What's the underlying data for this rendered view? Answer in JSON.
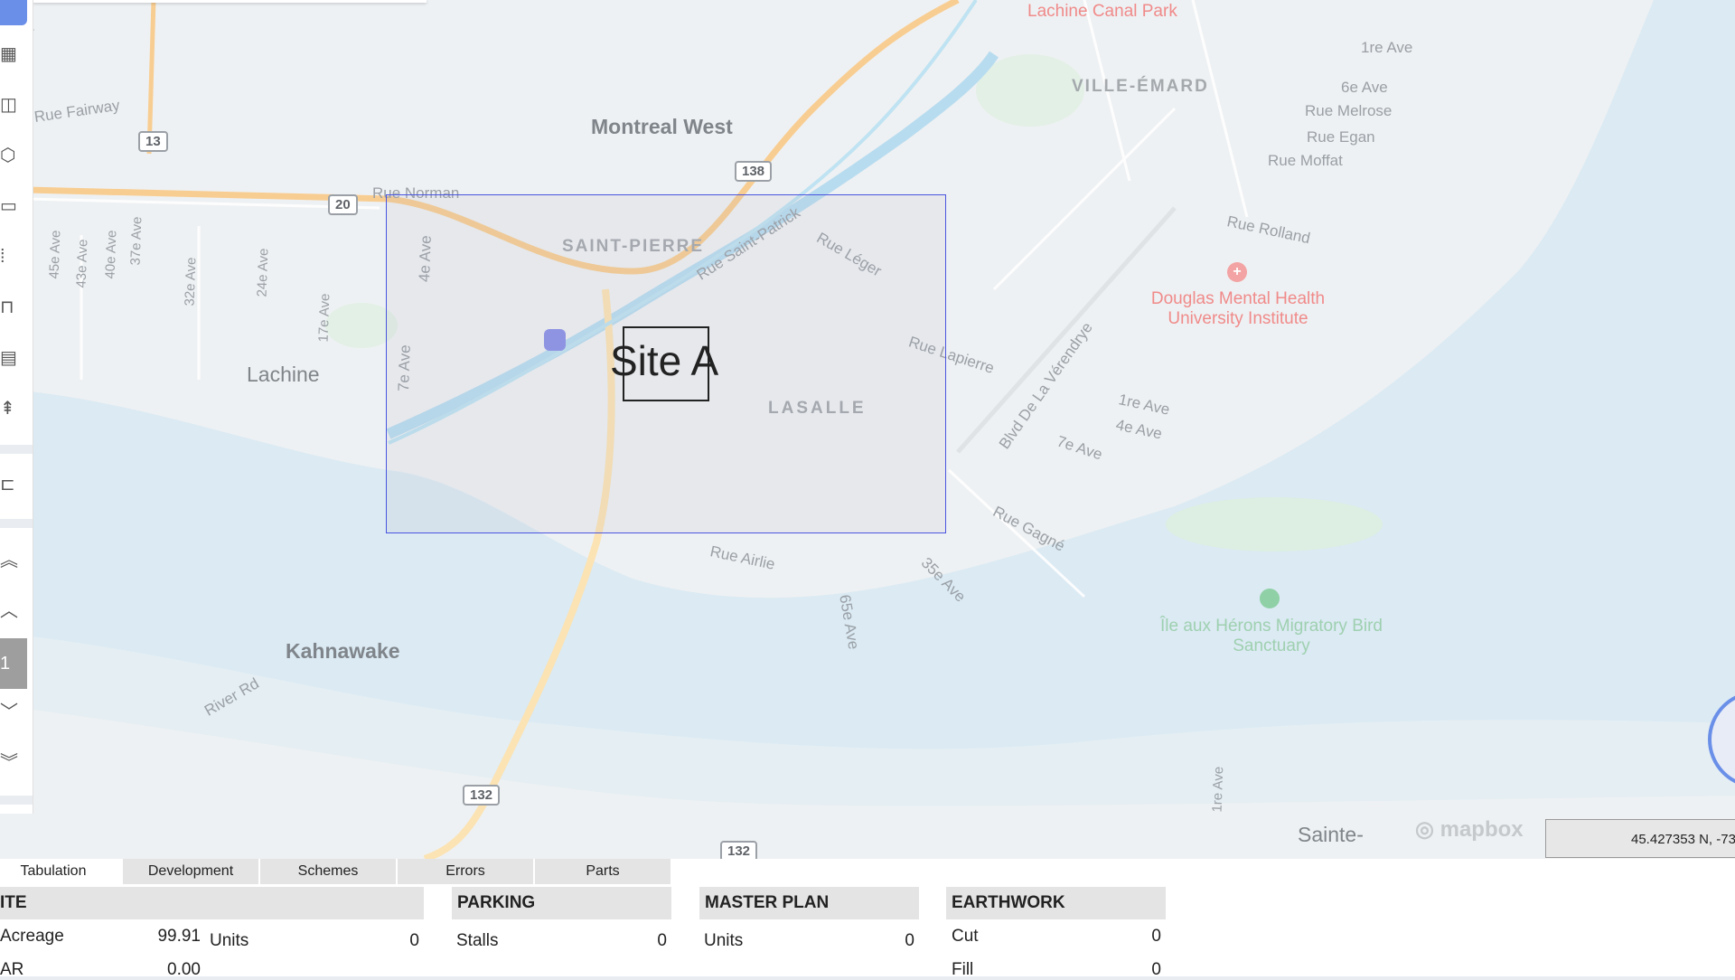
{
  "map": {
    "labels": {
      "lachine_canal_park": "Lachine Canal Park",
      "montreal_west": "Montreal West",
      "ville_emard": "VILLE-ÉMARD",
      "saint_pierre": "SAINT-PIERRE",
      "lachine": "Lachine",
      "lasalle": "LASALLE",
      "kahnawake": "Kahnawake",
      "douglas": "Douglas Mental Health University Institute",
      "heron": "Île aux Hérons Migratory Bird Sanctuary",
      "sainte": "Sainte-",
      "rue_norman": "Rue Norman",
      "rue_fairway": "Rue Fairway",
      "rue_saint_patrick": "Rue Saint-Patrick",
      "rue_leger": "Rue Léger",
      "rue_lapierre": "Rue Lapierre",
      "rue_airlie": "Rue Airlie",
      "blvd_verendrye": "Blvd De La Vérendrye",
      "rue_melrose": "Rue Melrose",
      "rue_egan": "Rue Egan",
      "rue_moffat": "Rue Moffat",
      "rue_rolland": "Rue Rolland",
      "rue_gagne": "Rue Gagné",
      "river_rd": "River Rd",
      "ave_1re": "1re Ave",
      "ave_6e": "6e Ave",
      "ave_4e": "4e Ave",
      "ave_7e": "7e Ave",
      "ave_1re_b": "1re Ave",
      "ave_4e_b": "4e Ave",
      "ave_7e_b": "7e Ave",
      "ave_35e": "35e Ave",
      "ave_65e": "65e Ave",
      "ave_45e": "45e Ave",
      "ave_43e": "43e Ave",
      "ave_40e": "40e Ave",
      "ave_37e": "37e Ave",
      "ave_32e": "32e Ave",
      "ave_24e": "24e Ave",
      "ave_17e": "17e Ave",
      "ave_1re_c": "1re Ave"
    },
    "shields": {
      "r13": "13",
      "r138": "138",
      "r20": "20",
      "r132a": "132",
      "r132b": "132"
    },
    "site_label": "Site A",
    "attribution": "mapbox",
    "coords": "45.427353 N, -73"
  },
  "tabs": [
    {
      "label": "Tabulation"
    },
    {
      "label": "Development"
    },
    {
      "label": "Schemes"
    },
    {
      "label": "Errors"
    },
    {
      "label": "Parts"
    }
  ],
  "panels": {
    "site": {
      "title": "ITE",
      "acreage_label": "Acreage",
      "acreage": "99.91",
      "units_label": "Units",
      "units": "0",
      "far_label": "AR",
      "far": "0.00"
    },
    "parking": {
      "title": "PARKING",
      "stalls_label": "Stalls",
      "stalls": "0"
    },
    "master": {
      "title": "MASTER PLAN",
      "units_label": "Units",
      "units": "0"
    },
    "earthwork": {
      "title": "EARTHWORK",
      "cut_label": "Cut",
      "cut": "0",
      "fill_label": "Fill",
      "fill": "0"
    }
  },
  "colors": {
    "accent": "#4a55e0",
    "water": "#cfe6f5",
    "highway": "#f6c27a"
  },
  "icons": [
    "building-icon",
    "layers-icon",
    "polygon-icon",
    "car-icon",
    "parking-icon",
    "bench-icon",
    "ruler-icon",
    "tree-icon",
    "add-shape-icon",
    "chevron-double-up-icon",
    "chevron-up-icon",
    "chevron-down-icon",
    "chevron-double-down-icon"
  ]
}
